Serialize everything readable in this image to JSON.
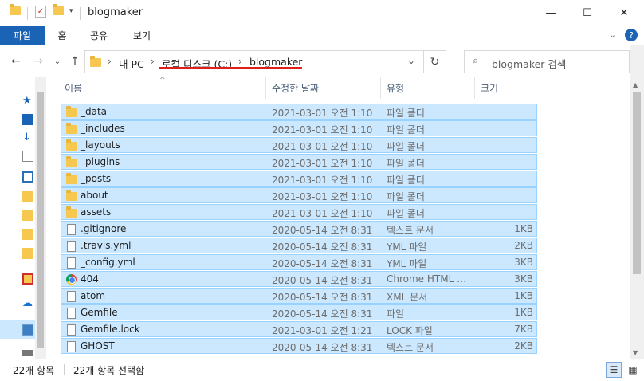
{
  "window": {
    "title": "blogmaker",
    "minimize_icon": "—",
    "maximize_icon": "☐",
    "close_icon": "✕"
  },
  "ribbon": {
    "tabs": [
      "파일",
      "홈",
      "공유",
      "보기"
    ],
    "accent": "#1a63b5"
  },
  "nav": {
    "back": "←",
    "forward": "→",
    "recent": "⌄",
    "up": "↑",
    "refresh": "↻",
    "dropdown": "⌄"
  },
  "address": {
    "crumbs": [
      "내 PC",
      "로컬 디스크 (C:)",
      "blogmaker"
    ],
    "separator": "›"
  },
  "search": {
    "placeholder": "blogmaker 검색"
  },
  "columns": {
    "name": "이름",
    "date": "수정한 날짜",
    "type": "유형",
    "size": "크기"
  },
  "files": [
    {
      "name": "_data",
      "date": "2021-03-01 오전 1:10",
      "type": "파일 폴더",
      "size": "",
      "icon": "folder-icon"
    },
    {
      "name": "_includes",
      "date": "2021-03-01 오전 1:10",
      "type": "파일 폴더",
      "size": "",
      "icon": "folder-icon"
    },
    {
      "name": "_layouts",
      "date": "2021-03-01 오전 1:10",
      "type": "파일 폴더",
      "size": "",
      "icon": "folder-icon"
    },
    {
      "name": "_plugins",
      "date": "2021-03-01 오전 1:10",
      "type": "파일 폴더",
      "size": "",
      "icon": "folder-icon"
    },
    {
      "name": "_posts",
      "date": "2021-03-01 오전 1:10",
      "type": "파일 폴더",
      "size": "",
      "icon": "folder-icon"
    },
    {
      "name": "about",
      "date": "2021-03-01 오전 1:10",
      "type": "파일 폴더",
      "size": "",
      "icon": "folder-icon"
    },
    {
      "name": "assets",
      "date": "2021-03-01 오전 1:10",
      "type": "파일 폴더",
      "size": "",
      "icon": "folder-icon"
    },
    {
      "name": ".gitignore",
      "date": "2020-05-14 오전 8:31",
      "type": "텍스트 문서",
      "size": "1KB",
      "icon": "text-file-icon"
    },
    {
      "name": ".travis.yml",
      "date": "2020-05-14 오전 8:31",
      "type": "YML 파일",
      "size": "2KB",
      "icon": "file-icon"
    },
    {
      "name": "_config.yml",
      "date": "2020-05-14 오전 8:31",
      "type": "YML 파일",
      "size": "3KB",
      "icon": "file-icon"
    },
    {
      "name": "404",
      "date": "2020-05-14 오전 8:31",
      "type": "Chrome HTML D...",
      "size": "3KB",
      "icon": "chrome-icon"
    },
    {
      "name": "atom",
      "date": "2020-05-14 오전 8:31",
      "type": "XML 문서",
      "size": "1KB",
      "icon": "file-icon"
    },
    {
      "name": "Gemfile",
      "date": "2020-05-14 오전 8:31",
      "type": "파일",
      "size": "1KB",
      "icon": "file-icon"
    },
    {
      "name": "Gemfile.lock",
      "date": "2021-03-01 오전 1:21",
      "type": "LOCK 파일",
      "size": "7KB",
      "icon": "file-icon"
    },
    {
      "name": "GHOST",
      "date": "2020-05-14 오전 8:31",
      "type": "텍스트 문서",
      "size": "2KB",
      "icon": "text-file-icon"
    }
  ],
  "status": {
    "count": "22개 항목",
    "selected": "22개 항목 선택함"
  },
  "colors": {
    "selection_bg": "#cce8ff",
    "selection_border": "#99d1ff",
    "folder": "#f6c84f",
    "underline_annotation": "#e0201b"
  }
}
